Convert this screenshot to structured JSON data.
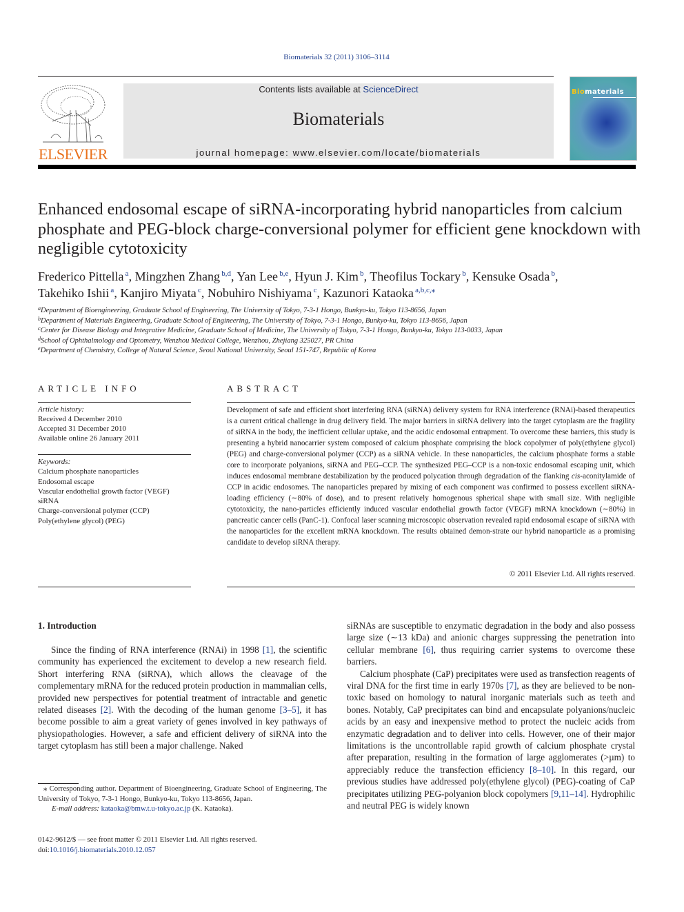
{
  "header": {
    "citation": "Biomaterials 32 (2011) 3106–3114",
    "contents_prefix": "Contents lists available at ",
    "contents_link": "ScienceDirect",
    "journal_name": "Biomaterials",
    "homepage": "journal homepage: www.elsevier.com/locate/biomaterials",
    "publisher_logo_text": "ELSEVIER",
    "cover_title_highlight": "Bio",
    "cover_title_rest": "materials",
    "colors": {
      "link": "#1c3c8c",
      "elsevier_orange": "#e9711c",
      "banner_bg": "#e6e6e6"
    }
  },
  "article": {
    "title": "Enhanced endosomal escape of siRNA-incorporating hybrid nanoparticles from calcium phosphate and PEG-block charge-conversional polymer for efficient gene knockdown with negligible cytotoxicity",
    "authors": [
      {
        "name": "Frederico Pittella",
        "aff": "a",
        "sep": ", "
      },
      {
        "name": "Mingzhen Zhang",
        "aff": "b,d",
        "sep": ", "
      },
      {
        "name": "Yan Lee",
        "aff": "b,e",
        "sep": ", "
      },
      {
        "name": "Hyun J. Kim",
        "aff": "b",
        "sep": ", "
      },
      {
        "name": "Theofilus Tockary",
        "aff": "b",
        "sep": ", "
      },
      {
        "name": "Kensuke Osada",
        "aff": "b",
        "sep": ","
      },
      {
        "name": "Takehiko Ishii",
        "aff": "a",
        "sep": ", "
      },
      {
        "name": "Kanjiro Miyata",
        "aff": "c",
        "sep": ", "
      },
      {
        "name": "Nobuhiro Nishiyama",
        "aff": "c",
        "sep": ", "
      },
      {
        "name": "Kazunori Kataoka",
        "aff": "a,b,c,⁎",
        "sep": ""
      }
    ],
    "affiliations": [
      {
        "key": "a",
        "text": "Department of Bioengineering, Graduate School of Engineering, The University of Tokyo, 7-3-1 Hongo, Bunkyo-ku, Tokyo 113-8656, Japan"
      },
      {
        "key": "b",
        "text": "Department of Materials Engineering, Graduate School of Engineering, The University of Tokyo, 7-3-1 Hongo, Bunkyo-ku, Tokyo 113-8656, Japan"
      },
      {
        "key": "c",
        "text": "Center for Disease Biology and Integrative Medicine, Graduate School of Medicine, The University of Tokyo, 7-3-1 Hongo, Bunkyo-ku, Tokyo 113-0033, Japan"
      },
      {
        "key": "d",
        "text": "School of Ophthalmology and Optometry, Wenzhou Medical College, Wenzhou, Zhejiang 325027, PR China"
      },
      {
        "key": "e",
        "text": "Department of Chemistry, College of Natural Science, Seoul National University, Seoul 151-747, Republic of Korea"
      }
    ]
  },
  "article_info": {
    "heading": "ARTICLE INFO",
    "history_label": "Article history:",
    "history": [
      "Received 4 December 2010",
      "Accepted 31 December 2010",
      "Available online 26 January 2011"
    ],
    "keywords_label": "Keywords:",
    "keywords": [
      "Calcium phosphate nanoparticles",
      "Endosomal escape",
      "Vascular endothelial growth factor (VEGF)",
      "siRNA",
      "Charge-conversional polymer (CCP)",
      "Poly(ethylene glycol) (PEG)"
    ]
  },
  "abstract": {
    "heading": "ABSTRACT",
    "text_part1": "Development of safe and efficient short interfering RNA (siRNA) delivery system for RNA interference (RNAi)-based therapeutics is a current critical challenge in drug delivery field. The major barriers in siRNA delivery into the target cytoplasm are the fragility of siRNA in the body, the inefficient cellular uptake, and the acidic endosomal entrapment. To overcome these barriers, this study is presenting a hybrid nanocarrier system composed of calcium phosphate comprising the block copolymer of poly(ethylene glycol) (PEG) and charge-conversional polymer (CCP) as a siRNA vehicle. In these nanoparticles, the calcium phosphate forms a stable core to incorporate polyanions, siRNA and PEG–CCP. The synthesized PEG–CCP is a non-toxic endosomal escaping unit, which induces endosomal membrane destabilization by the produced polycation through degradation of the flanking ",
    "text_italic": "cis",
    "text_part2": "-aconitylamide of CCP in acidic endosomes. The nanoparticles prepared by mixing of each component was confirmed to possess excellent siRNA-loading efficiency (∼80% of dose), and to present relatively homogenous spherical shape with small size. With negligible cytotoxicity, the nano-particles efficiently induced vascular endothelial growth factor (VEGF) mRNA knockdown (∼80%) in pancreatic cancer cells (PanC-1). Confocal laser scanning microscopic observation revealed rapid endosomal escape of siRNA with the nanoparticles for the excellent mRNA knockdown. The results obtained demon-strate our hybrid nanoparticle as a promising candidate to develop siRNA therapy.",
    "copyright": "© 2011 Elsevier Ltd. All rights reserved."
  },
  "body": {
    "section_heading": "1.  Introduction",
    "col1": [
      {
        "t": "Since the finding of RNA interference (RNAi) in 1998 "
      },
      {
        "ref": "[1]"
      },
      {
        "t": ", the scientific community has experienced the excitement to develop a new research field. Short interfering RNA (siRNA), which allows the cleavage of the complementary mRNA for the reduced protein production in mammalian cells, provided new perspectives for potential treatment of intractable and genetic related diseases "
      },
      {
        "ref": "[2]"
      },
      {
        "t": ". With the decoding of the human genome "
      },
      {
        "ref": "[3–5]"
      },
      {
        "t": ", it has become possible to aim a great variety of genes involved in key pathways of physiopathologies. However, a safe and efficient delivery of siRNA into the target cytoplasm has still been a major challenge. Naked"
      }
    ],
    "col2_p1": [
      {
        "t": "siRNAs are susceptible to enzymatic degradation in the body and also possess large size (∼13 kDa) and anionic charges suppressing the penetration into cellular membrane "
      },
      {
        "ref": "[6]"
      },
      {
        "t": ", thus requiring carrier systems to overcome these barriers."
      }
    ],
    "col2_p2": [
      {
        "t": "Calcium phosphate (CaP) precipitates were used as transfection reagents of viral DNA for the first time in early 1970s "
      },
      {
        "ref": "[7]"
      },
      {
        "t": ", as they are believed to be non-toxic based on homology to natural inorganic materials such as teeth and bones. Notably, CaP precipitates can bind and encapsulate polyanions/nucleic acids by an easy and inexpensive method to protect the nucleic acids from enzymatic degradation and to deliver into cells. However, one of their major limitations is the uncontrollable rapid growth of calcium phosphate crystal after preparation, resulting in the formation of large agglomerates (>µm) to appreciably reduce the transfection efficiency "
      },
      {
        "ref": "[8–10]"
      },
      {
        "t": ". In this regard, our previous studies have addressed poly(ethylene glycol) (PEG)-coating of CaP precipitates utilizing PEG-polyanion block copolymers "
      },
      {
        "ref": "[9,11–14]"
      },
      {
        "t": ". Hydrophilic and neutral PEG is widely known"
      }
    ]
  },
  "footnote": {
    "corresponding": "⁎ Corresponding author. Department of Bioengineering, Graduate School of Engineering, The University of Tokyo, 7-3-1 Hongo, Bunkyo-ku, Tokyo 113-8656, Japan.",
    "email_label": "E-mail address:",
    "email": "kataoka@bmw.t.u-tokyo.ac.jp",
    "email_suffix": " (K. Kataoka).",
    "issn": "0142-9612/$ — see front matter © 2011 Elsevier Ltd. All rights reserved.",
    "doi_prefix": "doi:",
    "doi": "10.1016/j.biomaterials.2010.12.057"
  }
}
